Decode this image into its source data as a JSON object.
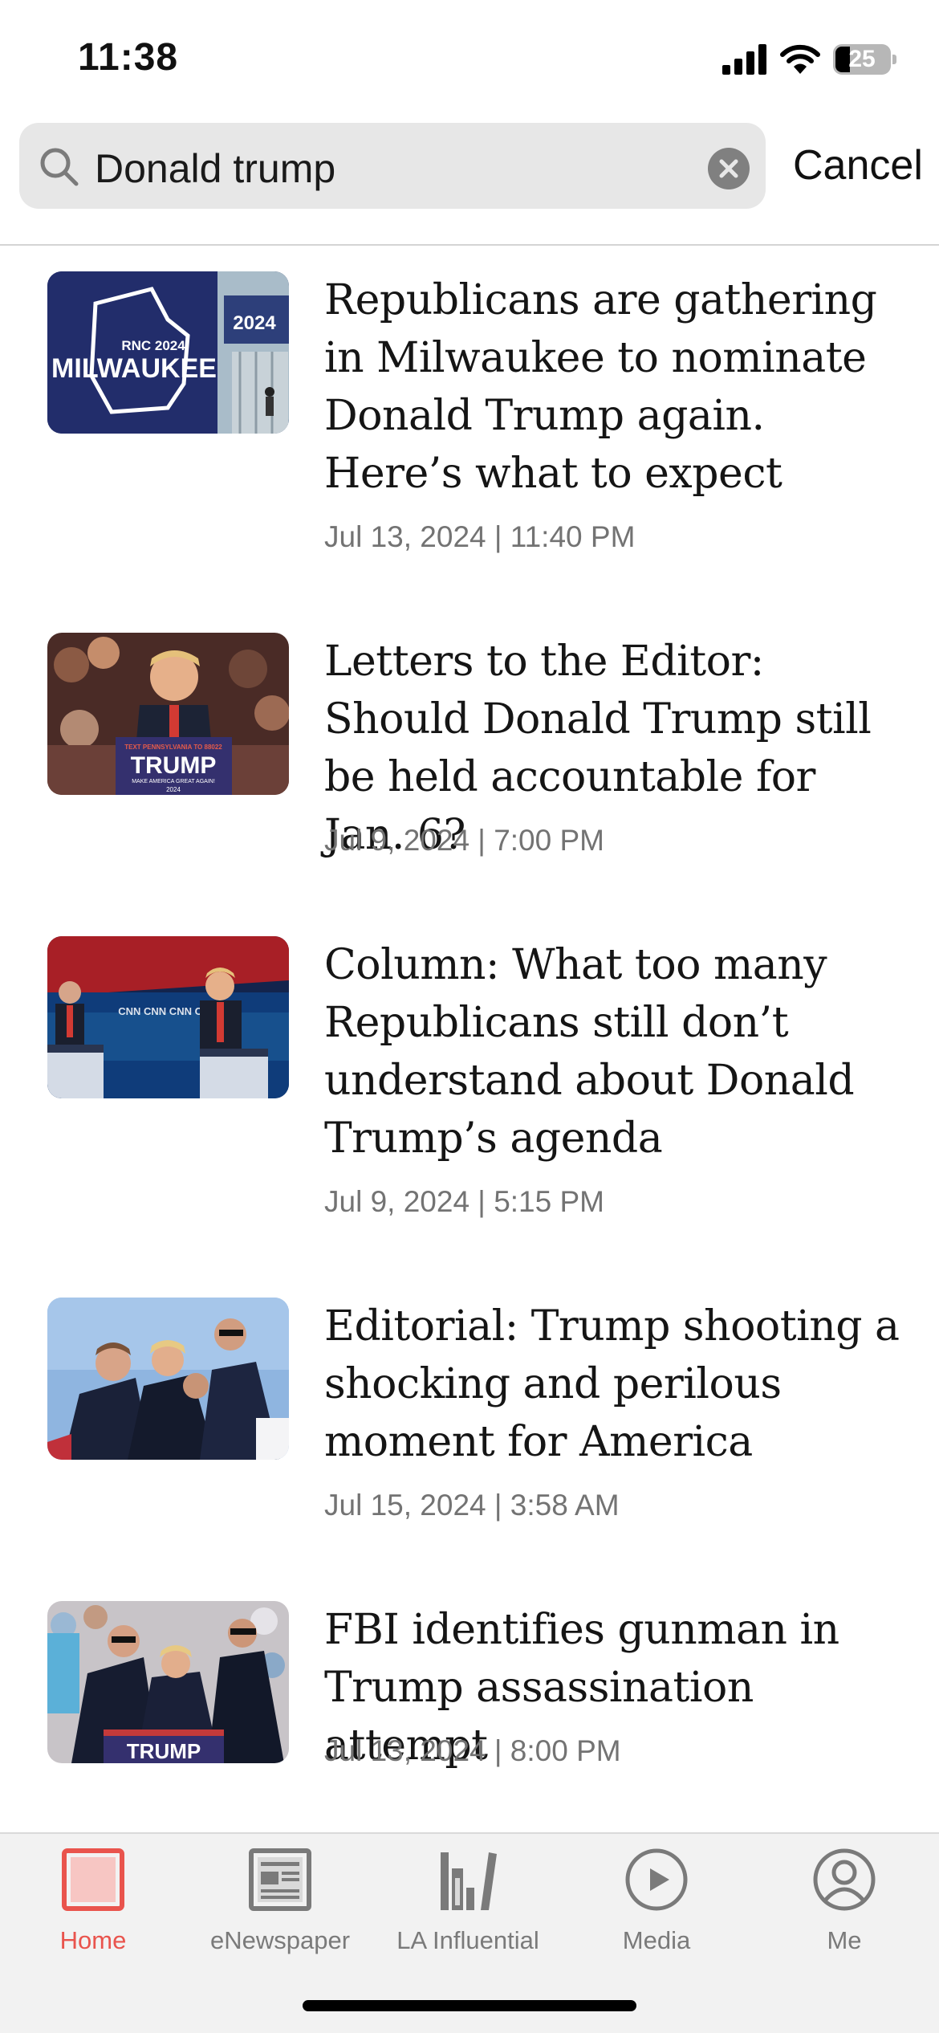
{
  "status_bar": {
    "time": "11:38",
    "battery": "25"
  },
  "search": {
    "query": "Donald trump",
    "cancel_label": "Cancel"
  },
  "articles": [
    {
      "title": "Republicans are gathering in Milwaukee to nominate Donald Trump again. Here’s what to expect",
      "date": "Jul 13, 2024 | 11:40 PM",
      "thumb_sign_text": "RNC 2024",
      "thumb_main_text": "MILWAUKEE",
      "thumb_side_text": "2024"
    },
    {
      "title": "Letters to the Editor: Should Donald Trump still be held accountable for Jan. 6?",
      "date": "Jul 9, 2024 | 7:00 PM",
      "thumb_sign_top": "TEXT PENNSYLVANIA TO 88022",
      "thumb_sign_text": "TRUMP",
      "thumb_sign_sub": "MAKE AMERICA GREAT AGAIN!",
      "thumb_sign_year": "2024"
    },
    {
      "title": "Column: What too many Republicans still don’t understand about Donald Trump’s agenda",
      "date": "Jul 9, 2024 | 5:15 PM",
      "thumb_sign_text": "CNN CNN CNN CNN"
    },
    {
      "title": "Editorial: Trump shooting a shocking and perilous moment for America",
      "date": "Jul 15, 2024 | 3:58 AM"
    },
    {
      "title": "FBI identifies gunman in Trump assassination attempt",
      "date": "Jul 13, 2024 | 8:00 PM",
      "thumb_sign_text": "TRUMP"
    }
  ],
  "tabs": [
    {
      "label": "Home",
      "icon": "home-icon",
      "active": true
    },
    {
      "label": "eNewspaper",
      "icon": "newspaper-icon",
      "active": false
    },
    {
      "label": "LA Influential",
      "icon": "books-icon",
      "active": false
    },
    {
      "label": "Media",
      "icon": "play-icon",
      "active": false
    },
    {
      "label": "Me",
      "icon": "person-icon",
      "active": false
    }
  ],
  "colors": {
    "accent": "#e9544d",
    "inactive_tab": "#7a7a7a",
    "date_text": "#737373",
    "search_bg": "#e7e7e7"
  }
}
